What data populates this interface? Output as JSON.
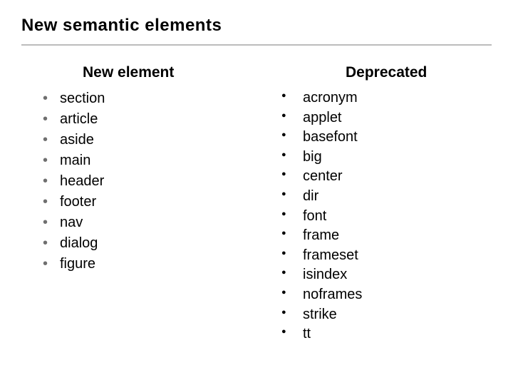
{
  "title": "New semantic elements",
  "left": {
    "heading": "New element",
    "items": [
      "section",
      "article",
      "aside",
      "main",
      "header",
      "footer",
      "nav",
      "dialog",
      "figure"
    ]
  },
  "right": {
    "heading": "Deprecated",
    "items": [
      "acronym",
      "applet",
      "basefont",
      "big",
      "center",
      "dir",
      "font",
      "frame",
      "frameset",
      "isindex",
      "noframes",
      "strike",
      "tt"
    ]
  }
}
